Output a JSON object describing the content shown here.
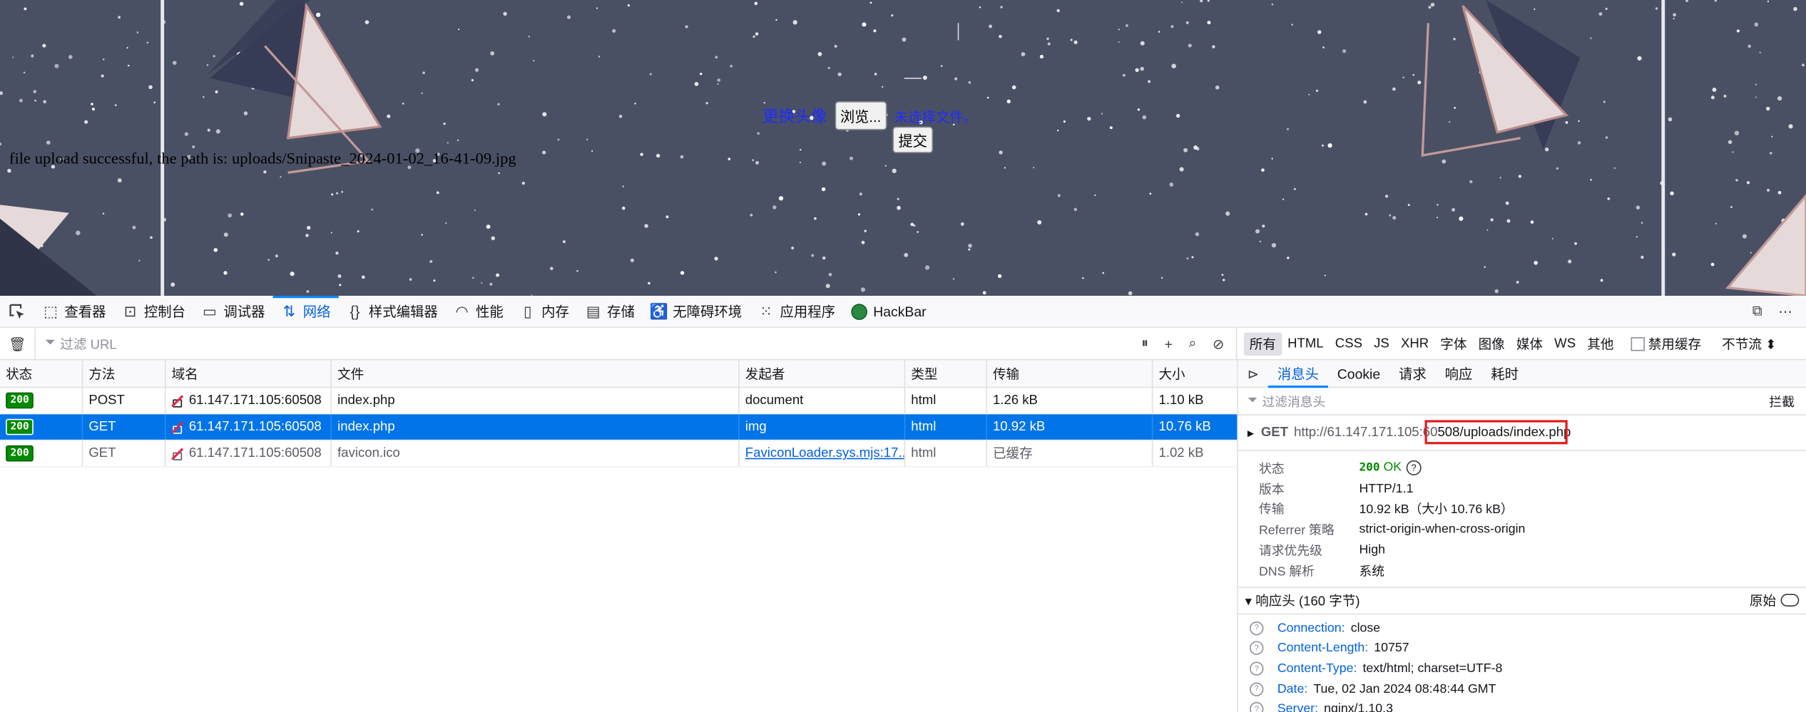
{
  "page": {
    "upload_label": "更换头像",
    "browse_label": "浏览...",
    "no_file_label": "未选择文件。",
    "submit_label": "提交",
    "success_message": "file upload successful, the path is: uploads/Snipaste_2024-01-02_16-41-09.jpg"
  },
  "devtools": {
    "tabs": [
      {
        "label": "查看器",
        "icon": "inspector-icon"
      },
      {
        "label": "控制台",
        "icon": "console-icon"
      },
      {
        "label": "调试器",
        "icon": "debugger-icon"
      },
      {
        "label": "网络",
        "icon": "network-icon",
        "active": true
      },
      {
        "label": "样式编辑器",
        "icon": "style-editor-icon"
      },
      {
        "label": "性能",
        "icon": "performance-icon"
      },
      {
        "label": "内存",
        "icon": "memory-icon"
      },
      {
        "label": "存储",
        "icon": "storage-icon"
      },
      {
        "label": "无障碍环境",
        "icon": "accessibility-icon"
      },
      {
        "label": "应用程序",
        "icon": "application-icon"
      },
      {
        "label": "HackBar",
        "icon": "hackbar-icon"
      }
    ],
    "filter_placeholder": "过滤 URL",
    "type_filters": [
      "所有",
      "HTML",
      "CSS",
      "JS",
      "XHR",
      "字体",
      "图像",
      "媒体",
      "WS",
      "其他"
    ],
    "disable_cache_label": "禁用缓存",
    "throttle_label": "不节流 ⬍",
    "columns": {
      "status": "状态",
      "method": "方法",
      "domain": "域名",
      "file": "文件",
      "initiator": "发起者",
      "type": "类型",
      "transferred": "传输",
      "size": "大小"
    },
    "requests": [
      {
        "status": "200",
        "method": "POST",
        "domain": "61.147.171.105:60508",
        "file": "index.php",
        "initiator": "document",
        "type": "html",
        "transferred": "1.26 kB",
        "size": "1.10 kB"
      },
      {
        "status": "200",
        "method": "GET",
        "domain": "61.147.171.105:60508",
        "file": "index.php",
        "initiator": "img",
        "type": "html",
        "transferred": "10.92 kB",
        "size": "10.76 kB"
      },
      {
        "status": "200",
        "method": "GET",
        "domain": "61.147.171.105:60508",
        "file": "favicon.ico",
        "initiator": "FaviconLoader.sys.mjs:17...",
        "type": "html",
        "transferred": "已缓存",
        "size": "1.02 kB"
      }
    ],
    "details": {
      "tabs": [
        "消息头",
        "Cookie",
        "请求",
        "响应",
        "耗时"
      ],
      "filter_placeholder": "过滤消息头",
      "block_label": "拦截",
      "method": "GET",
      "url_prefix": "http://61.147.171.105:60",
      "url_rest": "508/uploads/index.php",
      "summary": {
        "status_k": "状态",
        "status_code": "200",
        "status_text": "OK",
        "version_k": "版本",
        "version_v": "HTTP/1.1",
        "transfer_k": "传输",
        "transfer_v": "10.92 kB（大小 10.76 kB）",
        "referrer_k": "Referrer 策略",
        "referrer_v": "strict-origin-when-cross-origin",
        "priority_k": "请求优先级",
        "priority_v": "High",
        "dns_k": "DNS 解析",
        "dns_v": "系统"
      },
      "response_headers_title": "响应头 (160 字节)",
      "raw_label": "原始",
      "headers": [
        {
          "k": "Connection:",
          "v": "close"
        },
        {
          "k": "Content-Length:",
          "v": "10757"
        },
        {
          "k": "Content-Type:",
          "v": "text/html; charset=UTF-8"
        },
        {
          "k": "Date:",
          "v": "Tue, 02 Jan 2024 08:48:44 GMT"
        },
        {
          "k": "Server:",
          "v": "nginx/1.10.3"
        }
      ]
    }
  }
}
